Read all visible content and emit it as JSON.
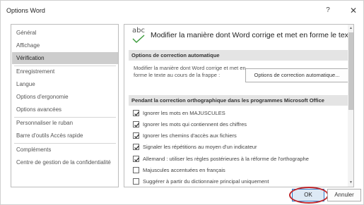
{
  "window": {
    "title": "Options Word",
    "help_label": "?",
    "close_label": "✕"
  },
  "nav": {
    "items": [
      {
        "label": "Général"
      },
      {
        "label": "Affichage"
      },
      {
        "label": "Vérification",
        "selected": true
      },
      {
        "label": "Enregistrement"
      },
      {
        "label": "Langue"
      },
      {
        "label": "Options d'ergonomie"
      },
      {
        "label": "Options avancées"
      },
      {
        "label": "Personnaliser le ruban"
      },
      {
        "label": "Barre d'outils Accès rapide"
      },
      {
        "label": "Compléments"
      },
      {
        "label": "Centre de gestion de la confidentialité"
      }
    ]
  },
  "content": {
    "header_icon_text": "abc",
    "header_text": "Modifier la manière dont Word corrige et met en forme le texte.",
    "autocorrect": {
      "section_title": "Options de correction automatique",
      "description": "Modifier la manière dont Word corrige et met en forme le texte au cours de la frappe :",
      "button_label": "Options de correction automatique..."
    },
    "spelling": {
      "section_title": "Pendant la correction orthographique dans les programmes Microsoft Office",
      "options": [
        {
          "label": "Ignorer les mots en MAJUSCULES",
          "checked": true
        },
        {
          "label": "Ignorer les mots qui contiennent des chiffres",
          "checked": true
        },
        {
          "label": "Ignorer les chemins d'accès aux fichiers",
          "checked": true
        },
        {
          "label": "Signaler les répétitions au moyen d'un indicateur",
          "checked": true
        },
        {
          "label": "Allemand : utiliser les règles postérieures à la réforme de l'orthographe",
          "checked": true
        },
        {
          "label": "Majuscules accentuées en français",
          "checked": false
        },
        {
          "label": "Suggérer à partir du dictionnaire principal uniquement",
          "checked": false
        }
      ]
    }
  },
  "footer": {
    "ok_label": "OK",
    "cancel_label": "Annuler"
  },
  "colors": {
    "selected_nav": "#cdcdcd",
    "section_header": "#e4e4e4",
    "ok_border": "#2b78c5",
    "annotation_circle": "#c0262b"
  }
}
